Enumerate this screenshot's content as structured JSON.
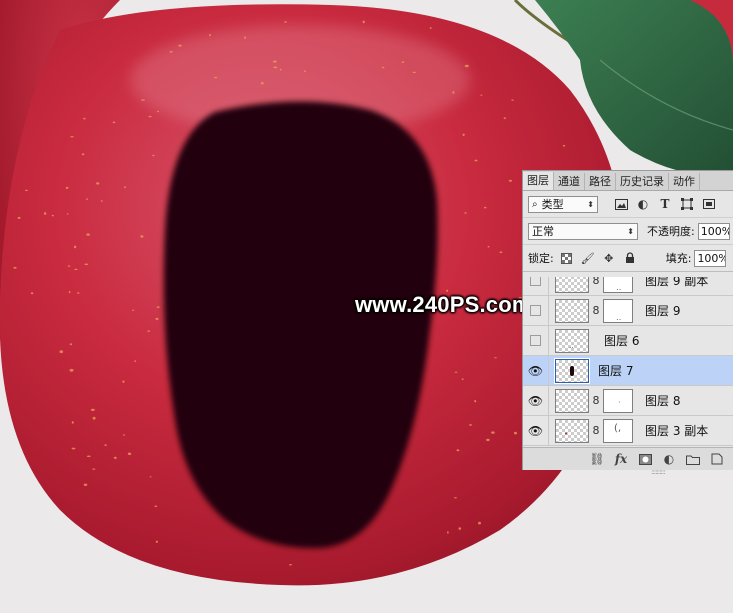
{
  "watermark": "www.240PS.com",
  "panel": {
    "tabs": [
      "图层",
      "通道",
      "路径",
      "历史记录",
      "动作"
    ],
    "active_tab": "图层",
    "filter": {
      "icon": "search-icon",
      "label": "类型"
    },
    "blend_mode": "正常",
    "opacity_label": "不透明度:",
    "opacity_value": "100%",
    "lock_label": "锁定:",
    "fill_label": "填充:",
    "fill_value": "100%",
    "layers": [
      {
        "name": "图层 9 副本",
        "visible": false,
        "has_mask": true,
        "selected": false
      },
      {
        "name": "图层 9",
        "visible": false,
        "has_mask": true,
        "selected": false
      },
      {
        "name": "图层 6",
        "visible": false,
        "has_mask": false,
        "selected": false
      },
      {
        "name": "图层 7",
        "visible": true,
        "has_mask": false,
        "selected": true
      },
      {
        "name": "图层 8",
        "visible": true,
        "has_mask": true,
        "selected": false
      },
      {
        "name": "图层 3 副本",
        "visible": true,
        "has_mask": true,
        "selected": false
      }
    ],
    "bottom_buttons": {
      "fx": "fx"
    }
  },
  "colors": {
    "apple_red": "#c8283c",
    "hole": "#200608",
    "leaf": "#2f6a45",
    "selected_row": "#bcd3f7"
  }
}
